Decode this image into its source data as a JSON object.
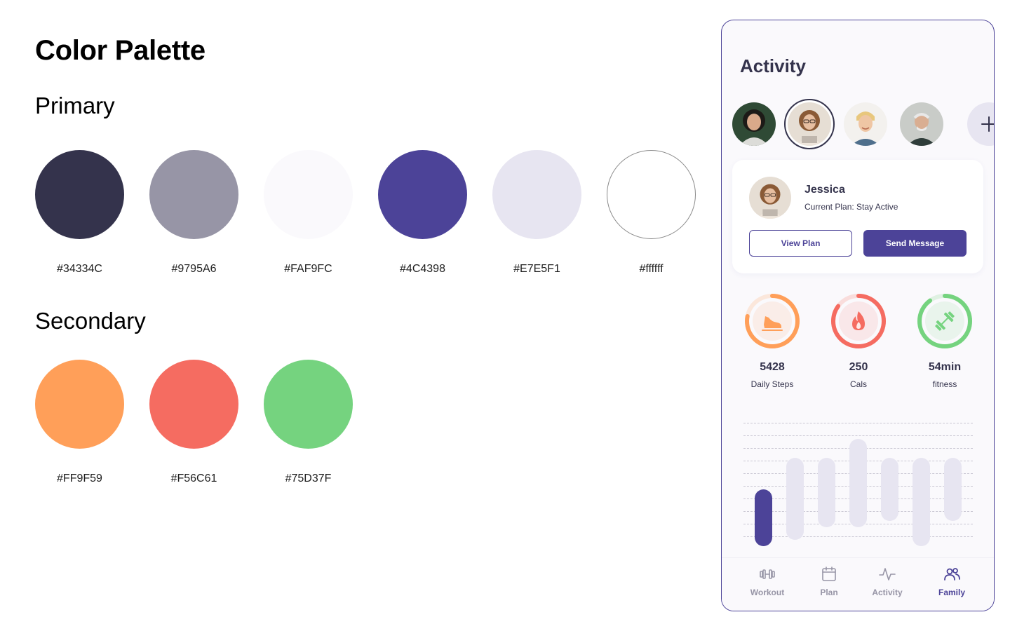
{
  "palette": {
    "title": "Color Palette",
    "primary_title": "Primary",
    "primary": [
      {
        "hex": "#34334C",
        "color": "#34334C"
      },
      {
        "hex": "#9795A6",
        "color": "#9795A6"
      },
      {
        "hex": "#FAF9FC",
        "color": "#FAF9FC"
      },
      {
        "hex": "#4C4398",
        "color": "#4C4398"
      },
      {
        "hex": "#E7E5F1",
        "color": "#E7E5F1"
      },
      {
        "hex": "#ffffff",
        "color": "#ffffff"
      }
    ],
    "secondary_title": "Secondary",
    "secondary": [
      {
        "hex": "#FF9F59",
        "color": "#FF9F59"
      },
      {
        "hex": "#F56C61",
        "color": "#F56C61"
      },
      {
        "hex": "#75D37F",
        "color": "#75D37F"
      }
    ]
  },
  "app": {
    "title": "Activity",
    "avatars": [
      "avatar-woman-dark-hair",
      "avatar-jessica",
      "avatar-young-man",
      "avatar-older-man"
    ],
    "selected_avatar": 1,
    "add_icon": "plus-icon",
    "profile": {
      "name": "Jessica",
      "plan": "Current Plan: Stay Active",
      "view_plan_label": "View Plan",
      "send_message_label": "Send Message"
    },
    "stats": [
      {
        "value": "5428",
        "label": "Daily Steps",
        "icon": "shoe-icon",
        "color": "#FF9F59",
        "progress": 0.78
      },
      {
        "value": "250",
        "label": "Cals",
        "icon": "flame-icon",
        "color": "#F56C61",
        "progress": 0.85
      },
      {
        "value": "54min",
        "label": "fitness",
        "icon": "dumbbell-icon",
        "color": "#75D37F",
        "progress": 0.9
      }
    ],
    "bar_levels": [
      {
        "start": 0.55,
        "end": 1.0,
        "highlight": true
      },
      {
        "start": 0.3,
        "end": 0.95,
        "highlight": false
      },
      {
        "start": 0.3,
        "end": 0.85,
        "highlight": false
      },
      {
        "start": 0.15,
        "end": 0.85,
        "highlight": false
      },
      {
        "start": 0.3,
        "end": 0.8,
        "highlight": false
      },
      {
        "start": 0.3,
        "end": 1.0,
        "highlight": false
      },
      {
        "start": 0.3,
        "end": 0.8,
        "highlight": false
      }
    ],
    "tabs": [
      {
        "label": "Workout",
        "icon": "dumbbell-icon",
        "active": false
      },
      {
        "label": "Plan",
        "icon": "calendar-icon",
        "active": false
      },
      {
        "label": "Activity",
        "icon": "activity-icon",
        "active": false
      },
      {
        "label": "Family",
        "icon": "family-icon",
        "active": true
      }
    ],
    "colors": {
      "accent": "#4C4398",
      "track": "#E7E5F1"
    }
  }
}
